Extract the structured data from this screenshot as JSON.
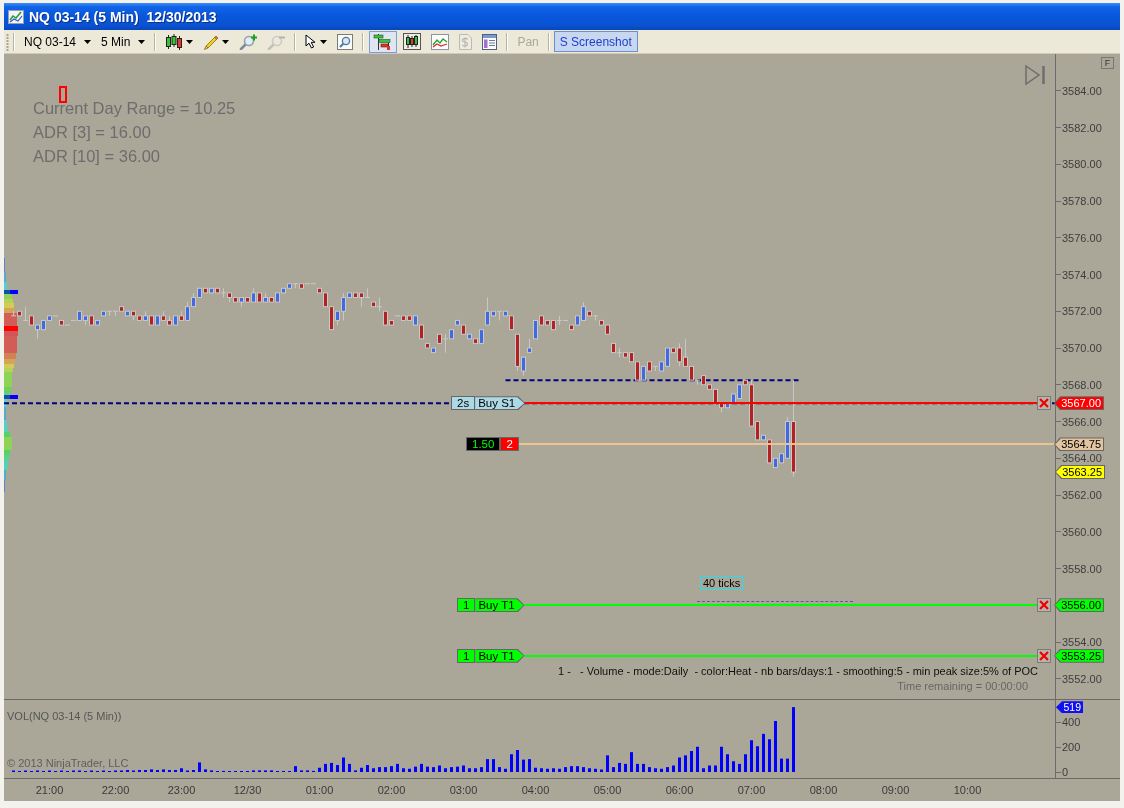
{
  "window": {
    "title": "NQ 03-14 (5 Min)  12/30/2013"
  },
  "toolbar": {
    "instrument": "NQ 03-14",
    "interval": "5 Min",
    "tool_groups": [
      [
        {
          "menu": true,
          "pressed": false,
          "disabled": false
        },
        {
          "menu": true,
          "pressed": false,
          "disabled": false
        },
        {
          "menu": false,
          "pressed": false,
          "disabled": false
        },
        {
          "menu": false,
          "pressed": false,
          "disabled": true
        }
      ],
      [
        {
          "menu": true,
          "pressed": false,
          "disabled": false
        },
        {
          "menu": false,
          "pressed": false,
          "disabled": false
        }
      ],
      [
        {
          "menu": false,
          "pressed": true,
          "disabled": false
        },
        {
          "menu": false,
          "pressed": false,
          "disabled": false
        },
        {
          "menu": false,
          "pressed": false,
          "disabled": false
        },
        {
          "menu": false,
          "pressed": false,
          "disabled": true
        },
        {
          "menu": false,
          "pressed": false,
          "disabled": false
        }
      ]
    ],
    "pan": {
      "label": "Pan",
      "disabled": true
    },
    "screenshot": {
      "label": "S Screenshot",
      "pressed": true
    }
  },
  "chart": {
    "price_panel": {
      "stats": [
        "Current Day Range = 10.25",
        "ADR [3] = 16.00",
        "ADR [10] = 36.00"
      ],
      "orders": [
        {
          "kind": "stop",
          "quantity": "2s",
          "label": "Buy S1",
          "price": "3567.00"
        },
        {
          "kind": "target",
          "quantity": "1",
          "label": "Buy T1",
          "price": "3556.00"
        },
        {
          "kind": "target",
          "quantity": "1",
          "label": "Buy T1",
          "price": "3553.25"
        }
      ],
      "position": {
        "pnl": "1.50",
        "quantity": "2",
        "price": "3564.75"
      },
      "last_price": "3563.25",
      "ruler_label": "40 ticks",
      "indicator_caption": "1 -   - Volume - mode:Daily  - color:Heat - nb bars/days:1 - smoothing:5 - min peak size:5% of POC",
      "time_remaining": "Time remaining = 00:00:00",
      "axis_badge": "F"
    },
    "volume_panel": {
      "title": "VOL(NQ 03-14 (5 Min))",
      "copyright": "© 2013 NinjaTrader, LLC",
      "last_value": "519"
    },
    "chart_data": [
      {
        "type": "candlestick",
        "categories": [
          null,
          null,
          null,
          null,
          null,
          null,
          null,
          null,
          null,
          null,
          null,
          null,
          null,
          null,
          null,
          null,
          null,
          null,
          null,
          null,
          null,
          null,
          null,
          null,
          null,
          null,
          null,
          null,
          null,
          null,
          null,
          null,
          null,
          null,
          null,
          null,
          null,
          null,
          null,
          null,
          null,
          null,
          null,
          null,
          null,
          null,
          null,
          null,
          null,
          null,
          null,
          null,
          null,
          null,
          null,
          null,
          null,
          null,
          null,
          null,
          null,
          null,
          null,
          null,
          null,
          null,
          null,
          null,
          null,
          null,
          null,
          null,
          null,
          null,
          null,
          null,
          null,
          null,
          null,
          null,
          null,
          null,
          null,
          null,
          null,
          null,
          null,
          null,
          null,
          null,
          null,
          null,
          null,
          null,
          null,
          null,
          null,
          null,
          null,
          null,
          null,
          null,
          null,
          null,
          null,
          null,
          null,
          null,
          null,
          null,
          null,
          null,
          null,
          null,
          null,
          null,
          null,
          null,
          null,
          null,
          null,
          null,
          null,
          null,
          null,
          null,
          null,
          null,
          null,
          null,
          null,
          null,
          null,
          null,
          null,
          null,
          null,
          null,
          null,
          null,
          null,
          null,
          null,
          null,
          null,
          null,
          null,
          null,
          null,
          null,
          null,
          null,
          null,
          null,
          null,
          null,
          null,
          null,
          null,
          null,
          null,
          null,
          null,
          null,
          null,
          null,
          null,
          null,
          null,
          null,
          null,
          null,
          null,
          null,
          null,
          null,
          null,
          null,
          null,
          null
        ],
        "ohlc": [
          null,
          [
            3571.75,
            3572,
            3571.75,
            3571.75
          ],
          [
            3572,
            3572,
            3571.75,
            3571.75
          ],
          [
            3571.5,
            3572.25,
            3571.5,
            3571.5
          ],
          [
            3571.75,
            3571.75,
            3571.25,
            3571.25
          ],
          [
            3571,
            3571.25,
            3570.5,
            3571.25
          ],
          [
            3571,
            3571.5,
            3571,
            3571.5
          ],
          [
            3571.5,
            3571.75,
            3571.5,
            3571.75
          ],
          [
            3571.75,
            3571.75,
            3571.75,
            3571.75
          ],
          [
            3571.5,
            3571.5,
            3571.25,
            3571.25
          ],
          [
            3571.25,
            3571.25,
            3571.25,
            3571.25
          ],
          [
            3571.5,
            3571.5,
            3571.5,
            3571.5
          ],
          [
            3571.5,
            3572,
            3571.5,
            3572
          ],
          [
            3571.5,
            3571.75,
            3571.25,
            3571.75
          ],
          [
            3571.75,
            3571.75,
            3571.25,
            3571.25
          ],
          [
            3571.25,
            3571.5,
            3571.25,
            3571.5
          ],
          [
            3571.75,
            3572,
            3571.75,
            3572
          ],
          [
            3572,
            3572,
            3571.75,
            3572
          ],
          [
            3572,
            3572,
            3571.75,
            3572
          ],
          [
            3572.25,
            3572.25,
            3572,
            3572
          ],
          [
            3571.75,
            3572,
            3571.75,
            3572
          ],
          [
            3572,
            3572,
            3571.5,
            3571.75
          ],
          [
            3571.75,
            3571.75,
            3571.5,
            3571.5
          ],
          [
            3571.5,
            3572,
            3571.5,
            3571.75
          ],
          [
            3571.75,
            3571.75,
            3571.25,
            3571.25
          ],
          [
            3571.25,
            3571.75,
            3571.25,
            3571.75
          ],
          [
            3571.75,
            3572,
            3571.5,
            3571.5
          ],
          [
            3571.5,
            3571.75,
            3571.25,
            3571.25
          ],
          [
            3571.25,
            3571.75,
            3571.25,
            3571.75
          ],
          [
            3571.75,
            3572,
            3571.5,
            3571.5
          ],
          [
            3571.5,
            3572.5,
            3571.5,
            3572.25
          ],
          [
            3572.25,
            3573,
            3572.25,
            3572.75
          ],
          [
            3572.75,
            3573.25,
            3572.75,
            3573.25
          ],
          [
            3573.25,
            3573.25,
            3573,
            3573
          ],
          [
            3573,
            3573.25,
            3573,
            3573.25
          ],
          [
            3573.25,
            3573.25,
            3573,
            3573
          ],
          [
            3573,
            3573.25,
            3572.75,
            3573
          ],
          [
            3573,
            3573,
            3572.5,
            3572.75
          ],
          [
            3572.75,
            3572.75,
            3572.5,
            3572.5
          ],
          [
            3572.5,
            3572.75,
            3572.25,
            3572.75
          ],
          [
            3572.75,
            3572.75,
            3572.5,
            3572.5
          ],
          [
            3572.5,
            3573.25,
            3572.5,
            3573
          ],
          [
            3573,
            3573,
            3572.5,
            3572.5
          ],
          [
            3572.5,
            3573,
            3572.5,
            3572.75
          ],
          [
            3572.75,
            3572.75,
            3572.5,
            3572.5
          ],
          [
            3572.5,
            3573,
            3572.5,
            3573
          ],
          [
            3573,
            3573.25,
            3573,
            3573.25
          ],
          [
            3573.25,
            3573.5,
            3573.25,
            3573.5
          ],
          [
            3573.5,
            3573.5,
            3573.25,
            3573.5
          ],
          [
            3573.5,
            3573.5,
            3573.25,
            3573.25
          ],
          [
            3573.5,
            3573.5,
            3573.5,
            3573.5
          ],
          [
            3573.5,
            3573.5,
            3573.5,
            3573.5
          ],
          [
            3573.25,
            3573.25,
            3573,
            3573
          ],
          [
            3573,
            3573,
            3572.25,
            3572.25
          ],
          [
            3572.25,
            3572.25,
            3571,
            3571
          ],
          [
            3571.5,
            3572,
            3571.25,
            3572
          ],
          [
            3572,
            3573,
            3571.5,
            3572.75
          ],
          [
            3572.75,
            3573,
            3572.75,
            3573
          ],
          [
            3573,
            3573,
            3572.75,
            3572.75
          ],
          [
            3573,
            3573,
            3572.25,
            3572.75
          ],
          [
            3572.75,
            3573.25,
            3572.75,
            3572.75
          ],
          [
            3572.5,
            3572.5,
            3572.25,
            3572.25
          ],
          [
            3572.25,
            3572.75,
            3572,
            3572.25
          ],
          [
            3572,
            3572,
            3571.25,
            3571.25
          ],
          [
            3571.5,
            3571.5,
            3571.25,
            3571.25
          ],
          [
            3571.75,
            3571.75,
            3571.75,
            3571.75
          ],
          [
            3571.75,
            3571.75,
            3571.5,
            3571.5
          ],
          [
            3571.75,
            3571.75,
            3571.5,
            3571.5
          ],
          [
            3571.25,
            3571.75,
            3571.25,
            3571.75
          ],
          [
            3571.25,
            3571.25,
            3570.5,
            3570.5
          ],
          [
            3570.25,
            3570.25,
            3570,
            3570
          ],
          [
            3569.75,
            3570,
            3569.75,
            3570
          ],
          [
            3570.75,
            3570.75,
            3570.25,
            3570.25
          ],
          [
            3570.5,
            3570.75,
            3569.75,
            3570.5
          ],
          [
            3570.5,
            3571,
            3570.5,
            3571
          ],
          [
            3571.25,
            3571.5,
            3571.25,
            3571.5
          ],
          [
            3571.25,
            3571.25,
            3570.75,
            3570.75
          ],
          [
            3570.5,
            3570.75,
            3570.5,
            3570.75
          ],
          [
            3570.5,
            3570.5,
            3570.25,
            3570.25
          ],
          [
            3570.25,
            3571,
            3570.25,
            3571
          ],
          [
            3571.25,
            3572.75,
            3571.25,
            3572
          ],
          [
            3571.75,
            3572,
            3571.75,
            3572
          ],
          [
            3572,
            3572,
            3571.5,
            3572
          ],
          [
            3571.75,
            3572,
            3571.75,
            3572
          ],
          [
            3571.75,
            3571.75,
            3571,
            3571
          ],
          [
            3570.75,
            3570.75,
            3568.75,
            3569
          ],
          [
            3568.75,
            3569.5,
            3568.5,
            3569.5
          ],
          [
            3569.75,
            3570.5,
            3569.75,
            3570
          ],
          [
            3570.5,
            3571.5,
            3570.5,
            3571.5
          ],
          [
            3571.75,
            3571.75,
            3571.25,
            3571.25
          ],
          [
            3571.5,
            3571.5,
            3571.25,
            3571.25
          ],
          [
            3571.5,
            3571.5,
            3571,
            3571
          ],
          [
            3571.5,
            3571.75,
            3571.25,
            3571.5
          ],
          [
            3571.5,
            3571.5,
            3571.5,
            3571.5
          ],
          [
            3571.25,
            3571.25,
            3571,
            3571
          ],
          [
            3571.25,
            3571.75,
            3571.25,
            3571.75
          ],
          [
            3571.5,
            3572.5,
            3571.5,
            3572.25
          ],
          [
            3572,
            3572,
            3571.75,
            3571.75
          ],
          [
            3571.75,
            3571.75,
            3571.5,
            3571.75
          ],
          [
            3571.5,
            3571.5,
            3571.25,
            3571.25
          ],
          [
            3571.25,
            3571.25,
            3570.75,
            3570.75
          ],
          [
            3570.25,
            3570.25,
            3569.75,
            3569.75
          ],
          [
            3569.75,
            3570,
            3569.5,
            3569.75
          ],
          [
            3569.75,
            3569.75,
            3569.5,
            3569.5
          ],
          [
            3569.75,
            3569.75,
            3569.25,
            3569.25
          ],
          [
            3569.25,
            3569.25,
            3568.25,
            3568.25
          ],
          [
            3568.25,
            3569,
            3568.25,
            3569
          ],
          [
            3569.25,
            3569.25,
            3568.75,
            3568.75
          ],
          [
            3569,
            3569,
            3568.75,
            3569
          ],
          [
            3568.75,
            3569.25,
            3568.75,
            3569.25
          ],
          [
            3569,
            3570,
            3569,
            3570
          ],
          [
            3570,
            3570,
            3569.75,
            3569.75
          ],
          [
            3570,
            3570.25,
            3569,
            3569.25
          ],
          [
            3569.5,
            3570.5,
            3569,
            3569
          ],
          [
            3569,
            3569,
            3568.25,
            3568.25
          ],
          [
            3568.25,
            3568.25,
            3568,
            3568.25
          ],
          [
            3568.5,
            3568.5,
            3568,
            3568
          ],
          [
            3568,
            3568,
            3567.75,
            3567.75
          ],
          [
            3567.75,
            3567.75,
            3567,
            3567
          ],
          [
            3567,
            3567,
            3566.5,
            3566.75
          ],
          [
            3566.75,
            3567,
            3566.75,
            3567
          ],
          [
            3567,
            3567.5,
            3567,
            3567.5
          ],
          [
            3567.25,
            3568,
            3567.25,
            3568
          ],
          [
            3568.25,
            3568.25,
            3568,
            3568
          ],
          [
            3568,
            3568.25,
            3565.75,
            3565.75
          ],
          [
            3566,
            3566,
            3565,
            3565
          ],
          [
            3565,
            3565.25,
            3565,
            3565.25
          ],
          [
            3565,
            3565,
            3563.75,
            3563.75
          ],
          [
            3563.5,
            3564,
            3563.5,
            3564
          ],
          [
            3563.75,
            3564.25,
            3563.75,
            3564.25
          ],
          [
            3564,
            3566.25,
            3564,
            3566
          ],
          [
            3566,
            3568.25,
            3563,
            3563.25
          ],
          null,
          null,
          null,
          null,
          null,
          null,
          null,
          null,
          null,
          null,
          null,
          null,
          null,
          null,
          null,
          null,
          null,
          null,
          null,
          null,
          null,
          null,
          null,
          null,
          null,
          null,
          null,
          null,
          null,
          null,
          null,
          null,
          null,
          null,
          null,
          null,
          null,
          null,
          null,
          null,
          null,
          null,
          null,
          null,
          null,
          null,
          null,
          null
        ],
        "series": [
          {
            "type": "line",
            "color": "#000080",
            "line_style": "dashed",
            "values": [
              null,
              null,
              null,
              null,
              null,
              null,
              null,
              null,
              null,
              null,
              null,
              null,
              null,
              null,
              null,
              null,
              null,
              null,
              null,
              null,
              null,
              null,
              null,
              null,
              null,
              null,
              null,
              null,
              null,
              null,
              null,
              null,
              null,
              null,
              null,
              null,
              null,
              null,
              null,
              null,
              null,
              null,
              null,
              null,
              null,
              null,
              null,
              null,
              null,
              null,
              null,
              null,
              null,
              null,
              null,
              null,
              null,
              null,
              null,
              null,
              null,
              null,
              null,
              null,
              null,
              null,
              null,
              null,
              null,
              null,
              null,
              null,
              null,
              null,
              null,
              null,
              null,
              null,
              null,
              null,
              null,
              null,
              null,
              3568.25,
              3568.25,
              3568.25,
              3568.25,
              3568.25,
              3568.25,
              3568.25,
              3568.25,
              3568.25,
              3568.25,
              3568.25,
              3568.25,
              3568.25,
              3568.25,
              3568.25,
              3568.25,
              3568.25,
              3568.25,
              3568.25,
              3568.25,
              3568.25,
              3568.25,
              3568.25,
              3568.25,
              3568.25,
              3568.25,
              3568.25,
              3568.25,
              3568.25,
              3568.25,
              3568.25,
              3568.25,
              3568.25,
              3568.25,
              3568.25,
              3568.25,
              3568.25,
              3568.25,
              3568.25,
              3568.25,
              3568.25,
              3568.25,
              3568.25,
              3568.25,
              3568.25,
              3568.25,
              3568.25,
              3568.25,
              3568.25,
              3568.25,
              null,
              null,
              null,
              null,
              null,
              null,
              null,
              null,
              null,
              null,
              null,
              null,
              null,
              null,
              null,
              null,
              null,
              null,
              null,
              null,
              null,
              null,
              null,
              null,
              null,
              null,
              null,
              null,
              null,
              null,
              null,
              null,
              null,
              null,
              null,
              null,
              null,
              null,
              null,
              null,
              null,
              null,
              null,
              null,
              null,
              null,
              null
            ]
          }
        ],
        "ylim": [
          3550.9,
          3586.0
        ],
        "yticks": [
          {
            "value": 3584,
            "label": "3584.00"
          },
          {
            "value": 3582,
            "label": "3582.00"
          },
          {
            "value": 3580,
            "label": "3580.00"
          },
          {
            "value": 3578,
            "label": "3578.00"
          },
          {
            "value": 3576,
            "label": "3576.00"
          },
          {
            "value": 3574,
            "label": "3574.00"
          },
          {
            "value": 3572,
            "label": "3572.00"
          },
          {
            "value": 3570,
            "label": "3570.00"
          },
          {
            "value": 3568,
            "label": "3568.00"
          },
          {
            "value": 3566,
            "label": "3566.00"
          },
          {
            "value": 3564,
            "label": "3564.00"
          },
          {
            "value": 3562,
            "label": "3562.00"
          },
          {
            "value": 3560,
            "label": "3560.00"
          },
          {
            "value": 3558,
            "label": "3558.00"
          },
          {
            "value": 3554,
            "label": "3554.00"
          },
          {
            "value": 3552,
            "label": "3552.00"
          }
        ],
        "tick_labels": "y",
        "ref_lines": [
          {
            "axis": "y",
            "value": 3567,
            "color": "#000080",
            "line_style": "dashed"
          }
        ]
      },
      {
        "type": "bar",
        "categories": [
          null,
          null,
          null,
          null,
          null,
          null,
          null,
          "21:00",
          null,
          null,
          null,
          null,
          null,
          null,
          null,
          null,
          null,
          null,
          "22:00",
          null,
          null,
          null,
          null,
          null,
          null,
          null,
          null,
          null,
          null,
          "23:00",
          null,
          null,
          null,
          null,
          null,
          null,
          null,
          null,
          null,
          null,
          "12/30",
          null,
          null,
          null,
          null,
          null,
          null,
          null,
          null,
          null,
          null,
          null,
          "01:00",
          null,
          null,
          null,
          null,
          null,
          null,
          null,
          null,
          null,
          null,
          null,
          "02:00",
          null,
          null,
          null,
          null,
          null,
          null,
          null,
          null,
          null,
          null,
          null,
          "03:00",
          null,
          null,
          null,
          null,
          null,
          null,
          null,
          null,
          null,
          null,
          null,
          "04:00",
          null,
          null,
          null,
          null,
          null,
          null,
          null,
          null,
          null,
          null,
          null,
          "05:00",
          null,
          null,
          null,
          null,
          null,
          null,
          null,
          null,
          null,
          null,
          null,
          "06:00",
          null,
          null,
          null,
          null,
          null,
          null,
          null,
          null,
          null,
          null,
          null,
          "07:00",
          null,
          null,
          null,
          null,
          null,
          null,
          null,
          null,
          null,
          null,
          null,
          "08:00",
          null,
          null,
          null,
          null,
          null,
          null,
          null,
          null,
          null,
          null,
          null,
          "09:00",
          null,
          null,
          null,
          null,
          null,
          null,
          null,
          null,
          null,
          null,
          null,
          "10:00",
          null,
          null,
          null,
          null,
          null,
          null,
          null,
          null,
          null,
          null,
          null,
          null,
          null,
          null,
          null,
          null,
          null,
          null,
          null
        ],
        "values": [
          null,
          12,
          8,
          12,
          8,
          12,
          8,
          12,
          8,
          12,
          8,
          12,
          12,
          8,
          12,
          8,
          12,
          8,
          12,
          12,
          16,
          12,
          16,
          16,
          21,
          16,
          21,
          16,
          16,
          30,
          12,
          16,
          77,
          21,
          13,
          8,
          9,
          8,
          8,
          8,
          8,
          13,
          13,
          13,
          13,
          8,
          8,
          8,
          47,
          13,
          13,
          9,
          34,
          65,
          73,
          56,
          116,
          65,
          13,
          34,
          56,
          30,
          39,
          39,
          47,
          65,
          30,
          26,
          43,
          65,
          43,
          39,
          52,
          30,
          39,
          43,
          52,
          30,
          30,
          39,
          103,
          103,
          39,
          26,
          142,
          176,
          99,
          103,
          34,
          30,
          26,
          30,
          26,
          39,
          47,
          47,
          39,
          30,
          26,
          20,
          133,
          39,
          73,
          65,
          159,
          65,
          65,
          39,
          30,
          26,
          39,
          52,
          116,
          133,
          168,
          202,
          30,
          52,
          52,
          202,
          142,
          86,
          65,
          142,
          254,
          206,
          305,
          262,
          408,
          107,
          107,
          519,
          null,
          null,
          null,
          null,
          null,
          null,
          null,
          null,
          null,
          null,
          null,
          null,
          null,
          null,
          null,
          null,
          null,
          null,
          null,
          null,
          null,
          null,
          null,
          null,
          null,
          null,
          null,
          null,
          null,
          null,
          null,
          null,
          null,
          null,
          null,
          null,
          null,
          null,
          null,
          null,
          null,
          null,
          null,
          null,
          null,
          null,
          null,
          null
        ],
        "color": "#0000ff",
        "ylim": [
          -48,
          576
        ],
        "yticks": [
          0,
          200,
          400
        ]
      }
    ]
  }
}
